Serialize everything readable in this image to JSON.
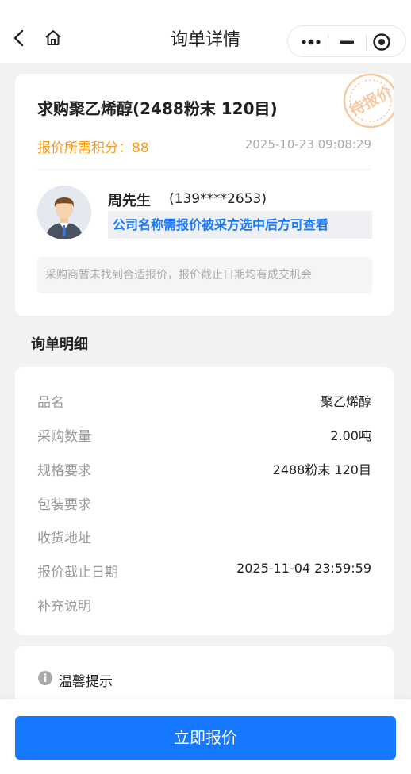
{
  "nav": {
    "title": "询单详情"
  },
  "inquiry": {
    "title": "求购聚乙烯醇(2488粉末 120目)",
    "stamp_text": "待报价",
    "points_label": "报价所需积分：",
    "points_value": "88",
    "datetime": "2025-10-23 09:08:29",
    "buyer_name": "周先生",
    "buyer_phone": "(139****2653)",
    "company_note": "公司名称需报价被采方选中后方可查看",
    "notice": "采购商暂未找到合适报价，报价截止日期均有成交机会"
  },
  "details": {
    "section_title": "询单明细",
    "rows": [
      {
        "label": "品名",
        "value": "聚乙烯醇"
      },
      {
        "label": "采购数量",
        "value": "2.00吨"
      },
      {
        "label": "规格要求",
        "value": "2488粉末 120目"
      },
      {
        "label": "包装要求",
        "value": ""
      },
      {
        "label": "收货地址",
        "value": ""
      },
      {
        "label": "报价截止日期",
        "value": "2025-11-04 23:59:59"
      },
      {
        "label": "补充说明",
        "value": ""
      }
    ]
  },
  "tips": {
    "label": "温馨提示"
  },
  "actions": {
    "quote_button": "立即报价"
  },
  "colors": {
    "primary": "#1677ff",
    "points": "#f59a1b",
    "stamp": "#f6c9a0"
  }
}
